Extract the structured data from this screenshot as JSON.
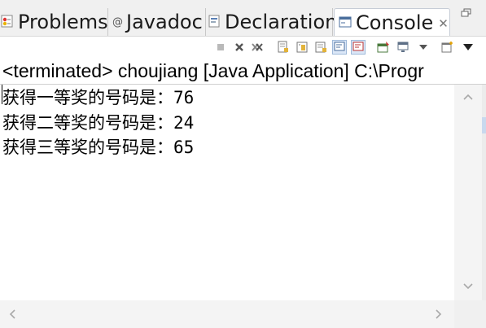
{
  "tabs": [
    {
      "label": "Problems",
      "icon": "problems-icon",
      "active": false
    },
    {
      "label": "Javadoc",
      "icon": "javadoc-icon",
      "active": false
    },
    {
      "label": "Declaration",
      "icon": "declaration-icon",
      "active": false
    },
    {
      "label": "Console",
      "icon": "console-icon",
      "active": true
    }
  ],
  "toolbar": {
    "icons": [
      "terminate-icon",
      "remove-launch-icon",
      "remove-all-terminated-icon",
      "clear-console-icon",
      "scroll-lock-icon",
      "word-wrap-icon",
      "show-on-stdout-icon",
      "show-on-stderr-icon",
      "pin-console-icon",
      "display-console-icon",
      "display-console-dropdown-icon",
      "new-console-icon",
      "view-menu-icon"
    ]
  },
  "console": {
    "header": "<terminated> choujiang [Java Application] C:\\Progr",
    "lines": [
      "获得一等奖的号码是：76",
      "获得二等奖的号码是：24",
      "获得三等奖的号码是：65"
    ]
  },
  "colors": {
    "tab_bar_bg": "#f0f0f0",
    "active_tab_border": "#c6ccd6",
    "pressed_button_bg": "#dbe7f7",
    "scrollbar_bg": "#f4f4f4"
  }
}
